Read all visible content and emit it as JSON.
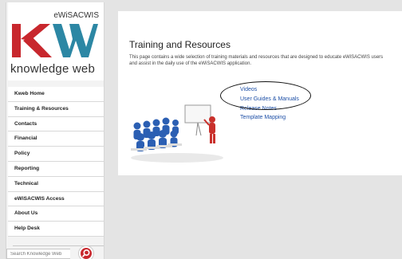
{
  "brand": {
    "top_text": "eWiSACWIS",
    "logo_letters": "KW",
    "name": "knowledge web"
  },
  "nav": {
    "items": [
      "Kweb Home",
      "Training & Resources",
      "Contacts",
      "Financial",
      "Policy",
      "Reporting",
      "Technical",
      "eWiSACWIS Access",
      "About Us",
      "Help Desk"
    ]
  },
  "search": {
    "placeholder": "Search Knowledge Web"
  },
  "main": {
    "title": "Training and Resources",
    "description": "This page contains a wide selection of training materials and resources that are designed to educate eWiSACWIS users and assist in the daily use of the eWiSACWIS application.",
    "links": [
      "Videos",
      "User Guides & Manuals",
      "Release Notes",
      "Template Mapping"
    ]
  },
  "colors": {
    "brand_red": "#c8272d",
    "brand_teal": "#2c87a4",
    "link": "#1d4fa6"
  }
}
